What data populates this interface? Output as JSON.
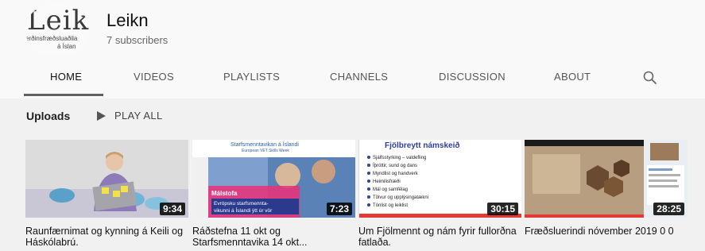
{
  "channel": {
    "logo_main": "Leikn",
    "logo_sub1": "erðinsfræðsluaðila",
    "logo_sub2": "á Íslan",
    "name": "Leikn",
    "subscribers": "7 subscribers"
  },
  "tabs": [
    {
      "label": "HOME",
      "active": true
    },
    {
      "label": "VIDEOS",
      "active": false
    },
    {
      "label": "PLAYLISTS",
      "active": false
    },
    {
      "label": "CHANNELS",
      "active": false
    },
    {
      "label": "DISCUSSION",
      "active": false
    },
    {
      "label": "ABOUT",
      "active": false
    }
  ],
  "uploads": {
    "title": "Uploads",
    "play_all": "PLAY ALL"
  },
  "videos": [
    {
      "title": "Raunfærnimat og kynning á Keili og Háskólabrú.",
      "duration": "9:34"
    },
    {
      "title": "Ráðstefna 11 okt og Starfsmenntavika 14 okt...",
      "duration": "7:23",
      "thumb_header": "Starfsmenntavikan á Íslandi",
      "thumb_sub": "European VET Skills Week",
      "thumb_badge": "Málstofa",
      "thumb_caption1": "Evrópsku starfsmennta-",
      "thumb_caption2": "vikunni á Íslandi ýtt úr vör"
    },
    {
      "title": "Um Fjölmennt og nám fyrir fullorðna fatlaða.",
      "duration": "30:15",
      "thumb_heading": "Fjölbreytt námskeið",
      "thumb_items": [
        "Sjálfsstyrking – valdefling",
        "Íþróttir, sund og dans",
        "Myndlist og handverk",
        "Heimilisfræði",
        "Mál og samfélag",
        "Tölvur og upplýsingatækni",
        "Tónlist og leiklist"
      ]
    },
    {
      "title": "Fræðsluerindi nóvember 2019 0 0",
      "duration": "28:25"
    }
  ],
  "colors": {
    "accent_red": "#e53935",
    "tab_underline": "#606060"
  }
}
